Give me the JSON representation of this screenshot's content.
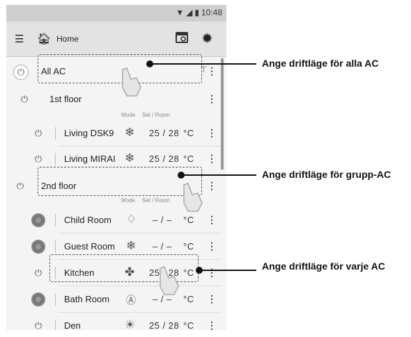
{
  "status": {
    "time": "10:48",
    "wifi_icon": "wifi-icon",
    "signal_icon": "signal-icon",
    "battery_icon": "battery-icon"
  },
  "toolbar": {
    "title": "Home",
    "menu_icon": "menu-icon",
    "home_icon": "home-icon",
    "schedule_icon": "schedule-icon",
    "settings_icon": "gear-icon"
  },
  "headers": {
    "mode": "Mode",
    "set_room": "Set / Room"
  },
  "rows": [
    {
      "name": "All AC",
      "power": "on",
      "kind": "all"
    },
    {
      "name": "1st floor",
      "power": "on",
      "kind": "group"
    },
    {
      "name": "Living DSK9",
      "power": "on",
      "mode_icon": "snowflake-icon",
      "set_room": "25 / 28",
      "unit": "°C"
    },
    {
      "name": "Living MIRAI",
      "power": "on",
      "mode_icon": "snowflake-icon",
      "set_room": "25 / 28",
      "unit": "°C"
    },
    {
      "name": "2nd floor",
      "power": "on",
      "kind": "group"
    },
    {
      "name": "Child Room",
      "power": "off",
      "mode_icon": "drop-icon",
      "set_room": "– / –",
      "unit": "°C"
    },
    {
      "name": "Guest Room",
      "power": "off",
      "mode_icon": "snowflake-icon",
      "set_room": "– / –",
      "unit": "°C"
    },
    {
      "name": "Kitchen",
      "power": "on",
      "mode_icon": "fan-icon",
      "set_room": "25 / 28",
      "unit": "°C"
    },
    {
      "name": "Bath Room",
      "power": "off",
      "mode_icon": "auto-icon",
      "set_room": "– / –",
      "unit": "°C"
    },
    {
      "name": "Den",
      "power": "on",
      "mode_icon": "sun-icon",
      "set_room": "25 / 28",
      "unit": "°C"
    }
  ],
  "callouts": [
    "Ange driftläge för alla AC",
    "Ange driftläge för grupp-AC",
    "Ange driftläge för varje AC"
  ]
}
